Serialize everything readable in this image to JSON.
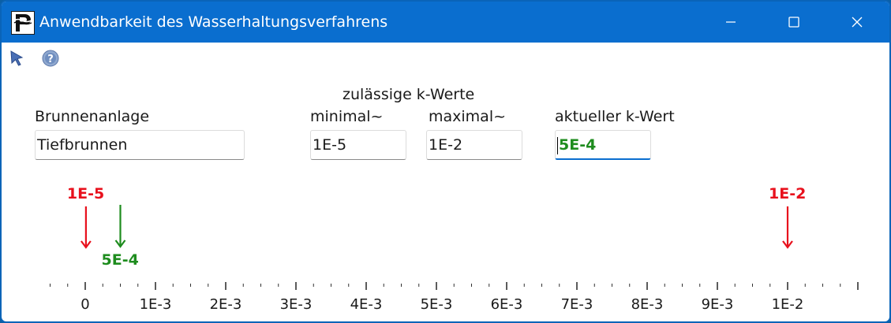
{
  "window": {
    "title": "Anwendbarkeit des Wasserhaltungsverfahrens",
    "accent": "#0a6ecf"
  },
  "toolbar": {
    "icons": [
      "pointer-icon",
      "help-icon"
    ]
  },
  "form": {
    "heading_allowed": "zulässige k-Werte",
    "installation_label": "Brunnenanlage",
    "installation_value": "Tiefbrunnen",
    "min_label": "minimal~",
    "min_value": "1E-5",
    "max_label": "maximal~",
    "max_value": "1E-2",
    "current_label": "aktueller k-Wert",
    "current_value": "5E-4"
  },
  "scale": {
    "min": 0,
    "max": 0.0109,
    "tick_labels": [
      "0",
      "1E-3",
      "2E-3",
      "3E-3",
      "4E-3",
      "5E-3",
      "6E-3",
      "7E-3",
      "8E-3",
      "9E-3",
      "1E-2"
    ],
    "tick_values": [
      0,
      0.001,
      0.002,
      0.003,
      0.004,
      0.005,
      0.006,
      0.007,
      0.008,
      0.009,
      0.01
    ],
    "minor_step": 0.00025,
    "markers": [
      {
        "label": "1E-5",
        "value": 1e-05,
        "color": "#e8111d",
        "kind": "min"
      },
      {
        "label": "1E-2",
        "value": 0.01,
        "color": "#e8111d",
        "kind": "max"
      },
      {
        "label": "5E-4",
        "value": 0.0005,
        "color": "#1e8c1e",
        "kind": "current"
      }
    ],
    "colors": {
      "limit": "#e8111d",
      "current": "#1e8c1e"
    }
  }
}
